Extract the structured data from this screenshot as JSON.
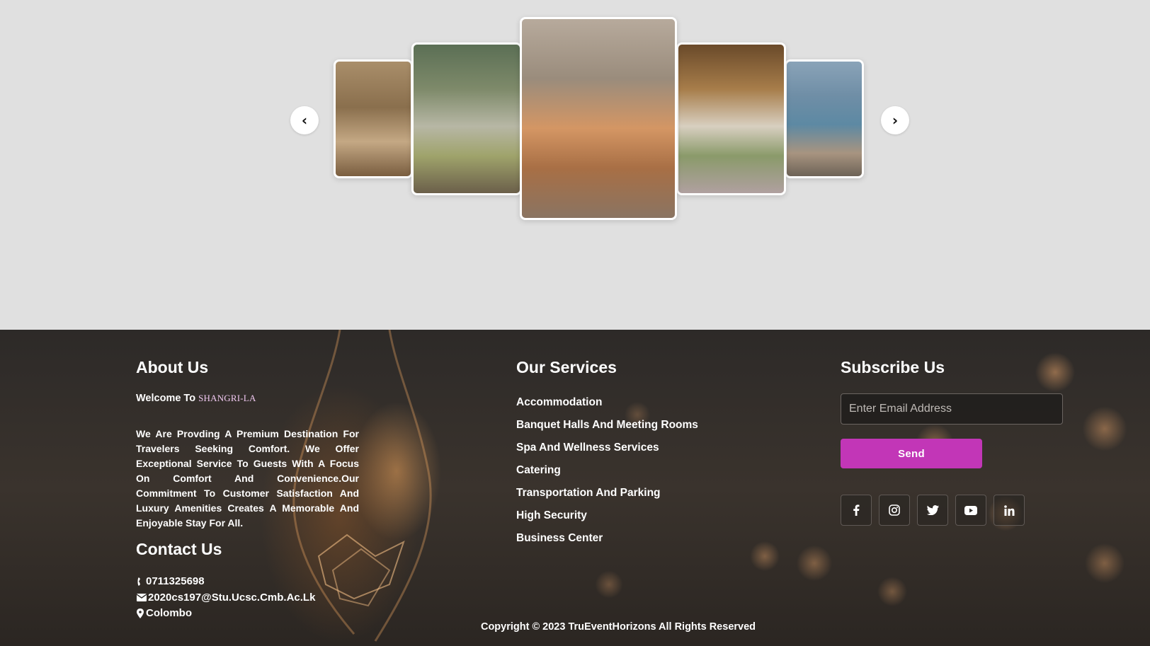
{
  "gallery": {
    "slides": [
      {
        "name": "lobby"
      },
      {
        "name": "courtyard-pool"
      },
      {
        "name": "hotel-entrance"
      },
      {
        "name": "banquet-hall"
      },
      {
        "name": "poolside"
      }
    ],
    "prev_icon": "chevron-left-icon",
    "prev_glyph": "‹",
    "next_icon": "chevron-right-icon",
    "next_glyph": "›"
  },
  "about": {
    "heading": "About Us",
    "welcome_prefix": "Welcome To",
    "brand": "SHANGRI-LA",
    "text": "We Are Provding A Premium Destination For Travelers Seeking Comfort. We Offer Exceptional Service To Guests With A Focus On Comfort And Convenience.Our Commitment To Customer Satisfaction And Luxury Amenities Creates A Memorable And Enjoyable Stay For All."
  },
  "contact": {
    "heading": "Contact Us",
    "phone": "0711325698",
    "email": "2020cs197@Stu.Ucsc.Cmb.Ac.Lk",
    "location": "Colombo"
  },
  "services": {
    "heading": "Our Services",
    "items": [
      "Accommodation",
      "Banquet Halls And Meeting Rooms",
      "Spa And Wellness Services",
      "Catering",
      "Transportation And Parking",
      "High Security",
      "Business Center"
    ]
  },
  "subscribe": {
    "heading": "Subscribe Us",
    "email_placeholder": "Enter Email Address",
    "email_value": "",
    "send_label": "Send",
    "socials": [
      "facebook-icon",
      "instagram-icon",
      "twitter-icon",
      "youtube-icon",
      "linkedin-icon"
    ]
  },
  "footer": {
    "copyright": "Copyright © 2023 TruEventHorizons All Rights Reserved"
  },
  "colors": {
    "accent": "#c236b7",
    "footer_bg": "#2d2a28",
    "gallery_bg": "#e0e0e0",
    "brand_text": "#f0c8f0"
  }
}
